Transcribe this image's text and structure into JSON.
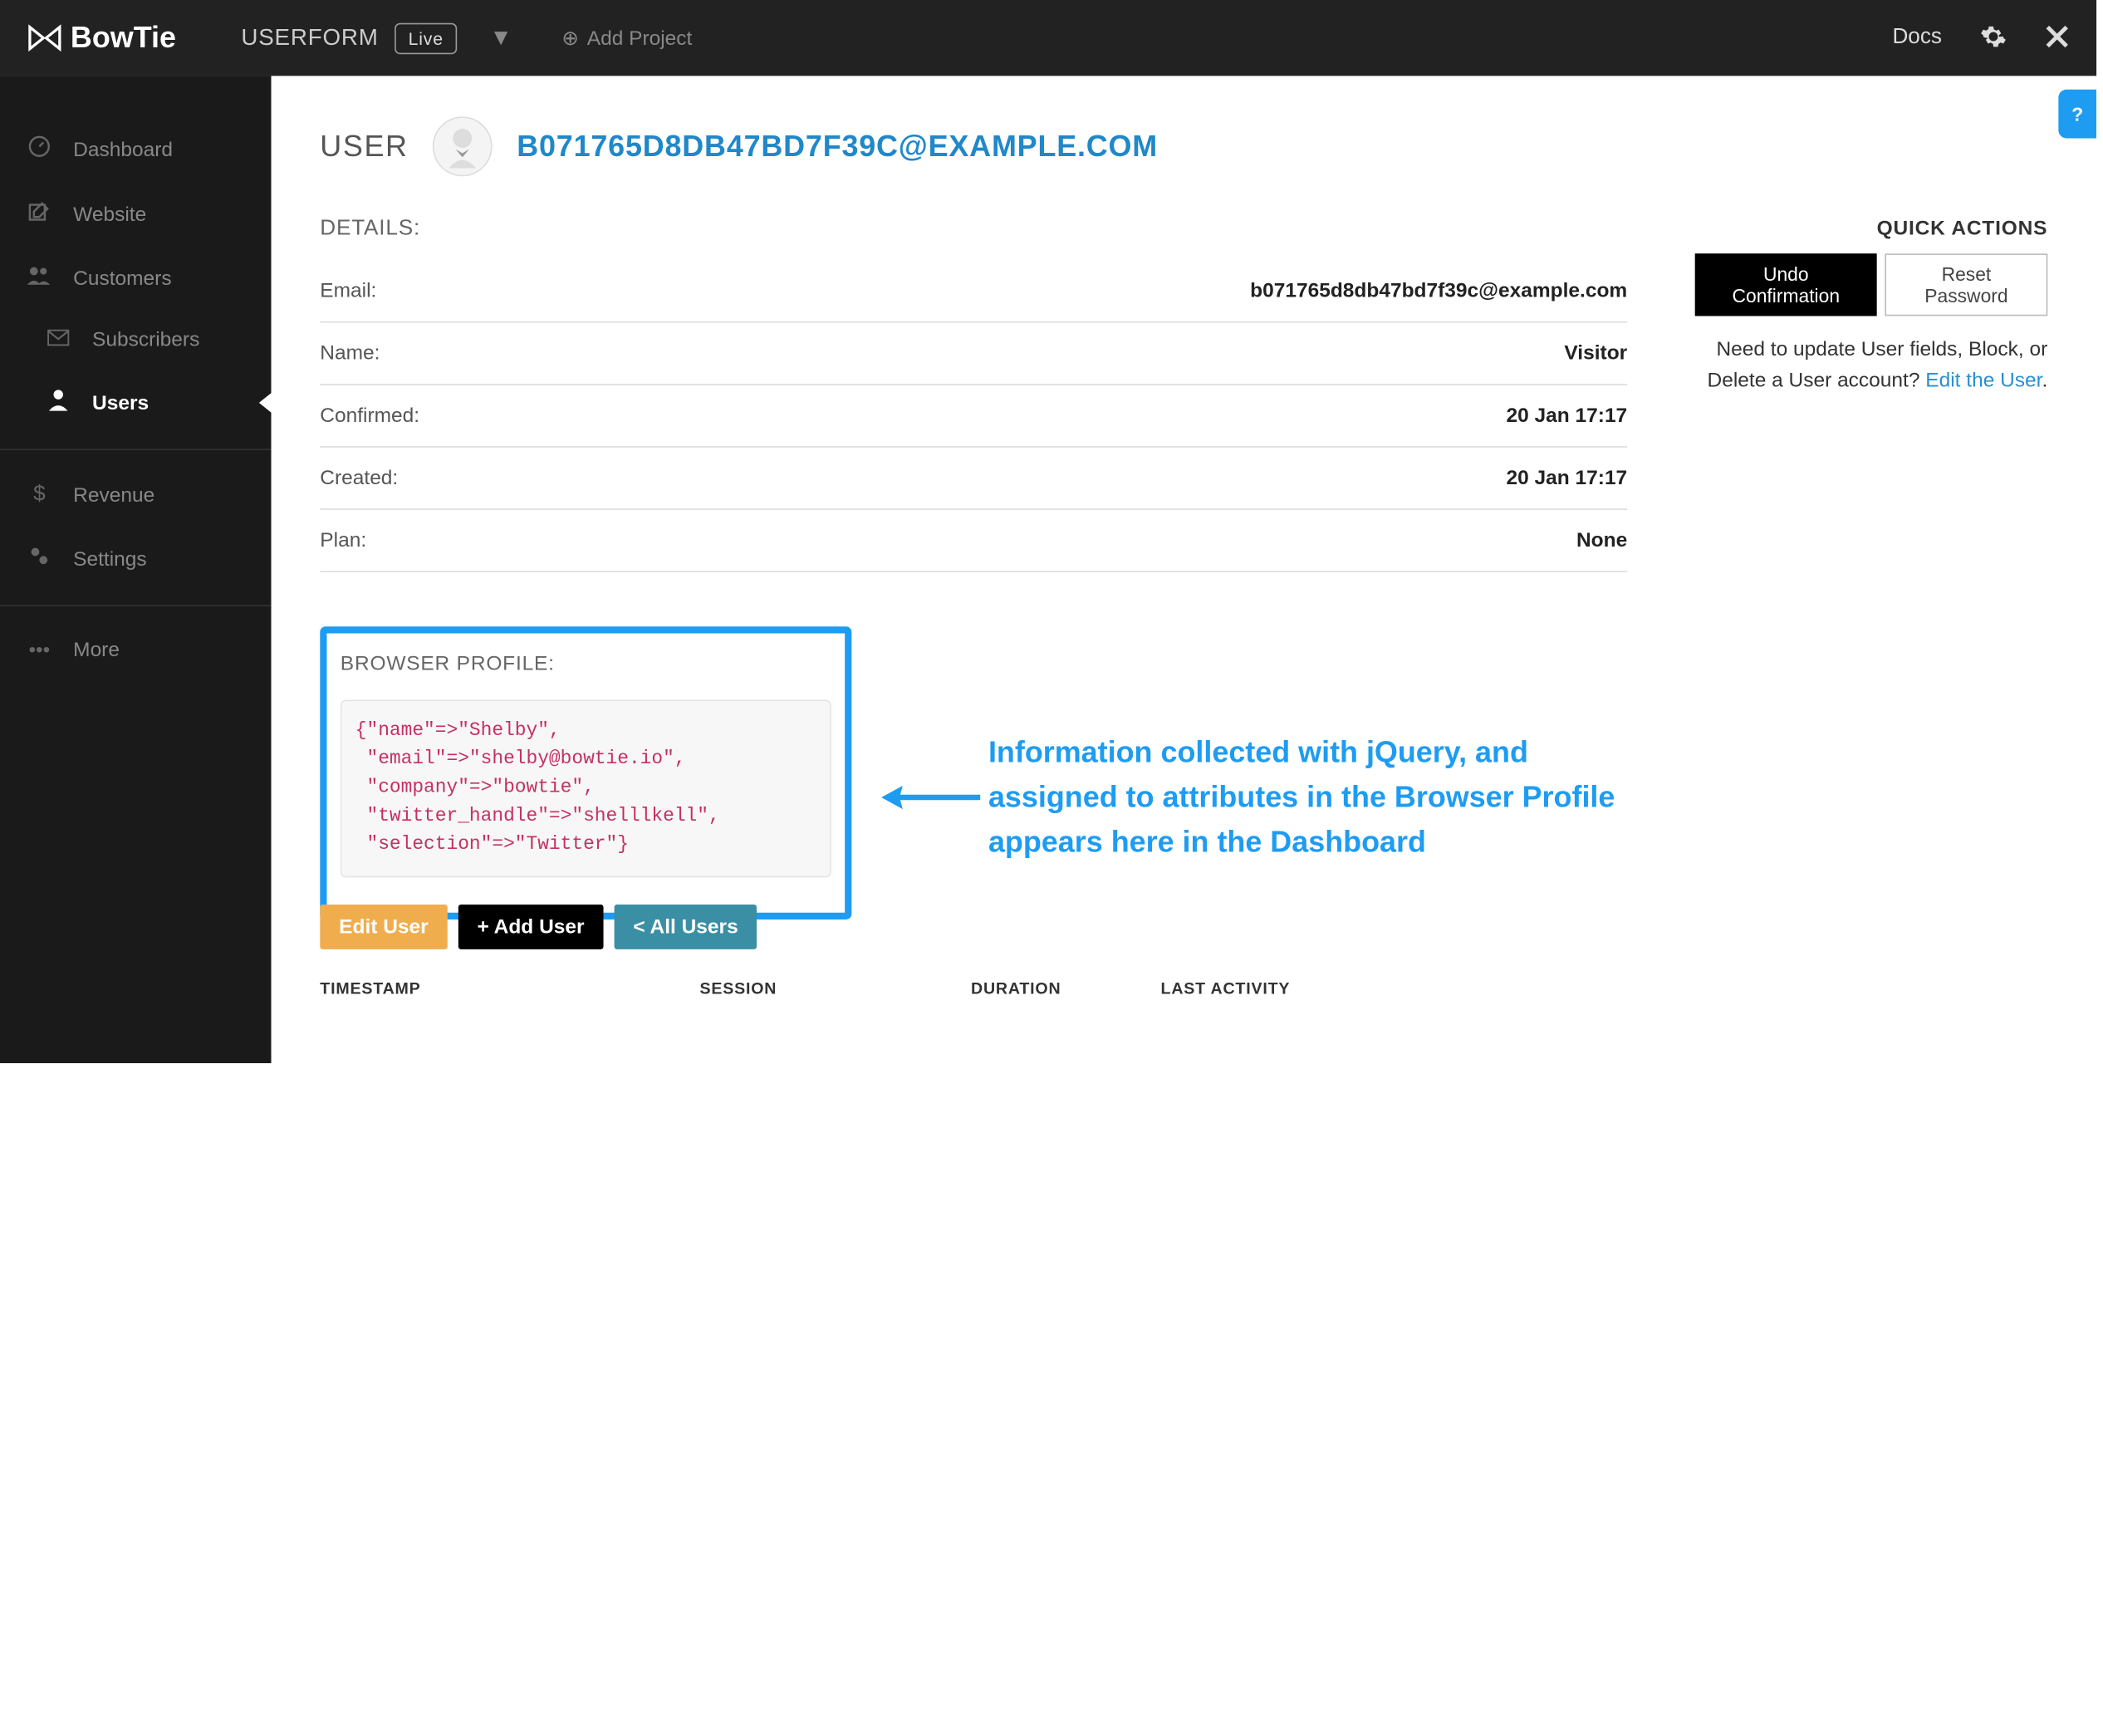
{
  "brand": "BowTie",
  "project_name": "USERFORM",
  "live_badge": "Live",
  "add_project": "Add Project",
  "topnav": {
    "docs": "Docs"
  },
  "sidebar": {
    "items": [
      {
        "label": "Dashboard"
      },
      {
        "label": "Website"
      },
      {
        "label": "Customers"
      },
      {
        "label": "Subscribers"
      },
      {
        "label": "Users"
      },
      {
        "label": "Revenue"
      },
      {
        "label": "Settings"
      },
      {
        "label": "More"
      }
    ]
  },
  "user": {
    "label": "USER",
    "email_upper": "B071765D8DB47BD7F39C@EXAMPLE.COM"
  },
  "details": {
    "title": "DETAILS:",
    "rows": [
      {
        "k": "Email:",
        "v": "b071765d8db47bd7f39c@example.com"
      },
      {
        "k": "Name:",
        "v": "Visitor"
      },
      {
        "k": "Confirmed:",
        "v": "20 Jan 17:17"
      },
      {
        "k": "Created:",
        "v": "20 Jan 17:17"
      },
      {
        "k": "Plan:",
        "v": "None"
      }
    ]
  },
  "quick": {
    "title": "QUICK ACTIONS",
    "undo": "Undo Confirmation",
    "reset": "Reset Password",
    "help_pre": "Need to update User fields, Block, or Delete a User account? ",
    "help_link": "Edit the User",
    "help_post": "."
  },
  "browser_profile": {
    "title": "BROWSER PROFILE:",
    "code": "{\"name\"=>\"Shelby\",\n \"email\"=>\"shelby@bowtie.io\",\n \"company\"=>\"bowtie\",\n \"twitter_handle\"=>\"shelllkell\",\n \"selection\"=>\"Twitter\"}"
  },
  "annotation": "Information collected with jQuery, and assigned to attributes in the Browser Profile appears here in the Dashboard",
  "actions": {
    "edit": "Edit User",
    "add": "+ Add User",
    "all": "< All Users"
  },
  "table": {
    "headers": [
      "TIMESTAMP",
      "SESSION",
      "DURATION",
      "LAST ACTIVITY"
    ]
  }
}
